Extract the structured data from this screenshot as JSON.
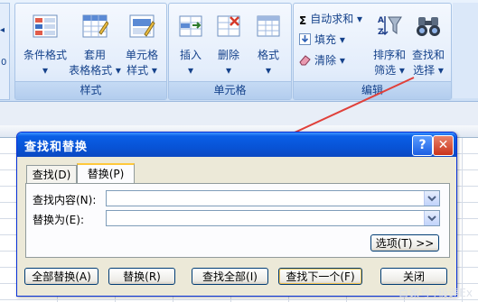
{
  "ribbon": {
    "styles_group": {
      "label": "样式",
      "buttons": [
        {
          "line1": "条件格式",
          "line2": "▾"
        },
        {
          "line1": "套用",
          "line2": "表格格式 ▾"
        },
        {
          "line1": "单元格",
          "line2": "样式 ▾"
        }
      ]
    },
    "cells_group": {
      "label": "单元格",
      "buttons": [
        {
          "line1": "插入",
          "line2": "▾"
        },
        {
          "line1": "删除",
          "line2": "▾"
        },
        {
          "line1": "格式",
          "line2": "▾"
        }
      ]
    },
    "editing_group": {
      "label": "编辑",
      "autosum": "自动求和 ▾",
      "fill": "填充 ▾",
      "clear": "清除 ▾",
      "sort_filter": {
        "line1": "排序和",
        "line2": "筛选 ▾"
      },
      "find_select": {
        "line1": "查找和",
        "line2": "选择 ▾"
      }
    }
  },
  "left_edge": {
    "top_char": "◂",
    "mid_char": "0"
  },
  "dialog": {
    "title": "查找和替换",
    "help_glyph": "?",
    "close_glyph": "✕",
    "tabs": [
      {
        "label": "查找(D)",
        "active": false
      },
      {
        "label": "替换(P)",
        "active": true
      }
    ],
    "find_label": "查找内容(N):",
    "find_value": "",
    "replace_label": "替换为(E):",
    "replace_value": "",
    "options_button": "选项(T) >>",
    "buttons": {
      "replace_all": "全部替换(A)",
      "replace": "替换(R)",
      "find_all": "查找全部(I)",
      "find_next": "查找下一个(F)",
      "close": "关闭"
    }
  },
  "watermark": "百家号 /极速Ex",
  "colors": {
    "accent_arrow": "#e0403a",
    "title_bar": "#0853d6",
    "ribbon_text": "#15428b"
  }
}
